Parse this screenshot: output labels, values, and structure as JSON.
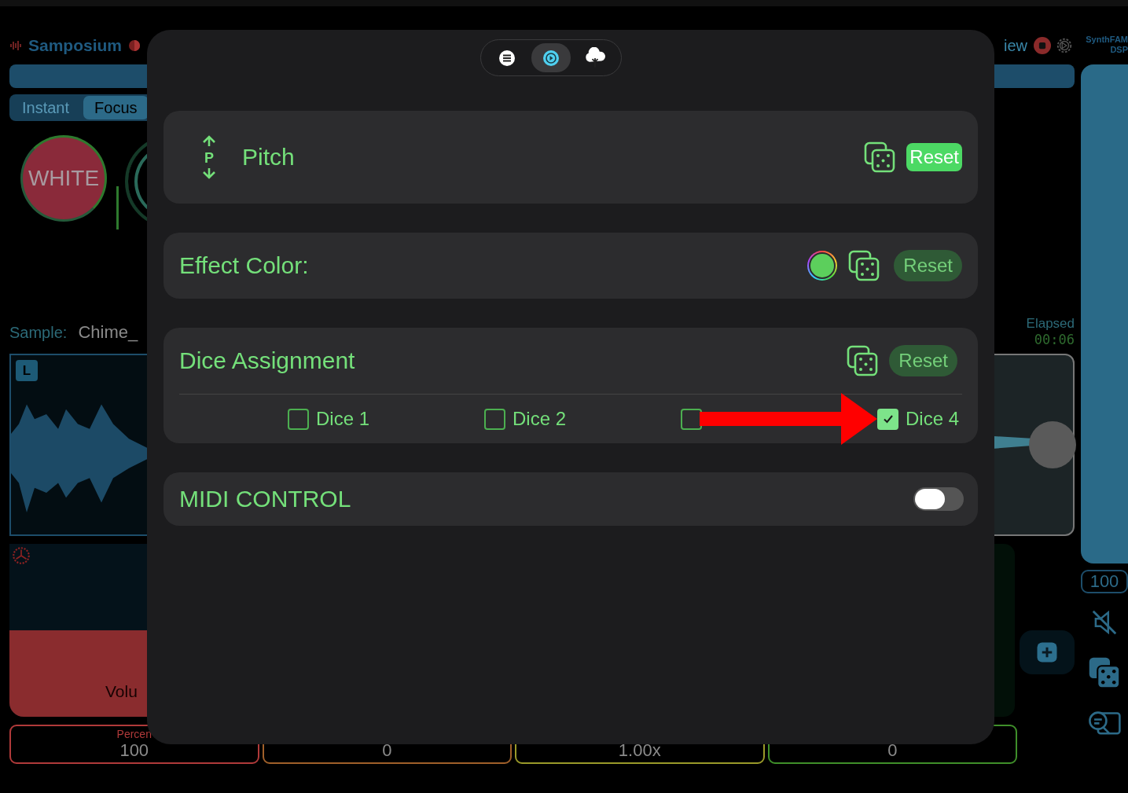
{
  "app": {
    "title": "Samposium",
    "view_label": "iew",
    "brand": [
      "SynthFAM",
      "DSP"
    ],
    "tabs": [
      {
        "label": "Instant",
        "selected": false
      },
      {
        "label": "Focus",
        "selected": true
      }
    ],
    "pad_label": "WHITE",
    "sample_label": "Sample:",
    "sample_name": "Chime_",
    "channel_badge": "L",
    "elapsed_label": "Elapsed",
    "elapsed_time": "00:06",
    "volume_label": "Volu",
    "volume_slider": {
      "level": 1
    },
    "side_value": "100",
    "fields": [
      {
        "caption": "Percen",
        "value": "100",
        "color": "#b03a3a"
      },
      {
        "value": "0",
        "color": "#a0602a"
      },
      {
        "value": "1.00x",
        "color": "#9a9a2a"
      },
      {
        "value": "0",
        "color": "#3f8f2a"
      }
    ]
  },
  "modal": {
    "tabs": [
      {
        "kind": "list",
        "selected": false
      },
      {
        "kind": "play",
        "selected": true
      },
      {
        "kind": "tree",
        "selected": false
      }
    ],
    "pitch": {
      "icon_letter": "P",
      "label": "Pitch",
      "reset": "Reset",
      "active": true
    },
    "effect_color": {
      "label": "Effect Color:",
      "color": "#5ccf5c",
      "reset": "Reset",
      "active": false
    },
    "dice": {
      "label": "Dice Assignment",
      "reset": "Reset",
      "active": false,
      "options": [
        {
          "label": "Dice 1",
          "checked": false
        },
        {
          "label": "Dice 2",
          "checked": false
        },
        {
          "checked": false
        },
        {
          "label": "Dice 4",
          "checked": true
        }
      ]
    },
    "midi": {
      "label": "MIDI CONTROL",
      "on": false
    }
  }
}
